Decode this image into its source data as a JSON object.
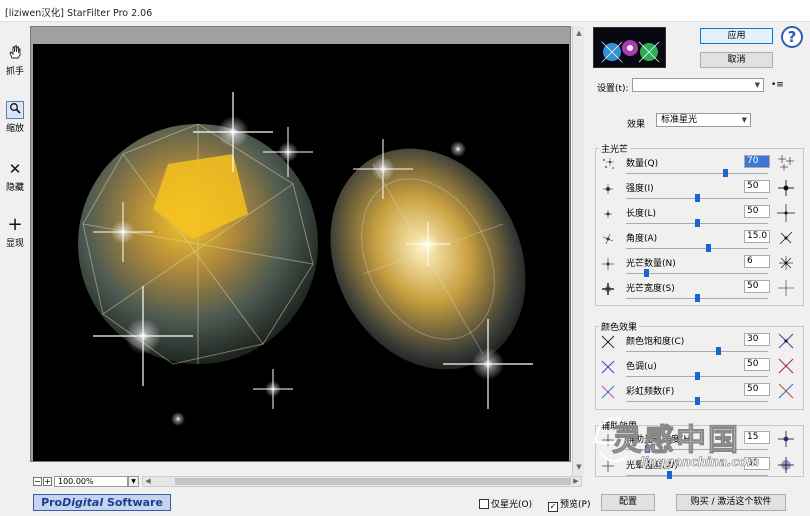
{
  "window": {
    "title": "[liziwen汉化] StarFilter Pro 2.06"
  },
  "tools": [
    {
      "label": "抓手",
      "icon": "hand-icon"
    },
    {
      "label": "缩放",
      "icon": "magnifier-icon"
    },
    {
      "label": "隐藏",
      "icon": "x-icon"
    },
    {
      "label": "显现",
      "icon": "plus-icon"
    }
  ],
  "zoom": {
    "minus": "−",
    "plus": "+",
    "value": "100.00%"
  },
  "footer": {
    "logo_pro": "Pro",
    "logo_digital": "Digital",
    "logo_software": " Software",
    "only_stars_label": "仅星光(O)",
    "only_stars_checked": false,
    "preview_label": "预览(P)",
    "preview_checked": true,
    "config_label": "配置",
    "buy_label": "购买 / 激活这个软件"
  },
  "actions": {
    "apply": "应用",
    "cancel": "取消",
    "help": "?"
  },
  "settings": {
    "label": "设置(t):",
    "value": "",
    "menu_glyph": "•≡"
  },
  "effect": {
    "label": "效果",
    "value": "标准星光"
  },
  "groups": {
    "main": "主光芒",
    "color": "颜色效果",
    "aux": "辅助效果"
  },
  "main_params": [
    {
      "name": "数量(Q)",
      "value": "70",
      "level": 0.7,
      "selected": true
    },
    {
      "name": "强度(I)",
      "value": "50",
      "level": 0.5
    },
    {
      "name": "长度(L)",
      "value": "50",
      "level": 0.5
    },
    {
      "name": "角度(A)",
      "value": "15.0",
      "level": 0.58
    },
    {
      "name": "光芒数量(N)",
      "value": "6",
      "level": 0.14
    },
    {
      "name": "光芒宽度(S)",
      "value": "50",
      "level": 0.5
    }
  ],
  "color_params": [
    {
      "name": "颜色饱和度(C)",
      "value": "30",
      "level": 0.65
    },
    {
      "name": "色调(u)",
      "value": "50",
      "level": 0.5
    },
    {
      "name": "彩虹频数(F)",
      "value": "50",
      "level": 0.5
    }
  ],
  "aux_params": [
    {
      "name": "辅助光芒强度(H)",
      "value": "15",
      "level": 0.15
    },
    {
      "name": "光晕强度(W)",
      "value": "30",
      "level": 0.3
    }
  ],
  "watermark": {
    "cn": "灵感中国",
    "url": "lingganchina.com"
  },
  "colors": {
    "accent": "#1a66d1",
    "logo_bg": "#c6d4ef",
    "logo_text": "#1d3d8f"
  }
}
